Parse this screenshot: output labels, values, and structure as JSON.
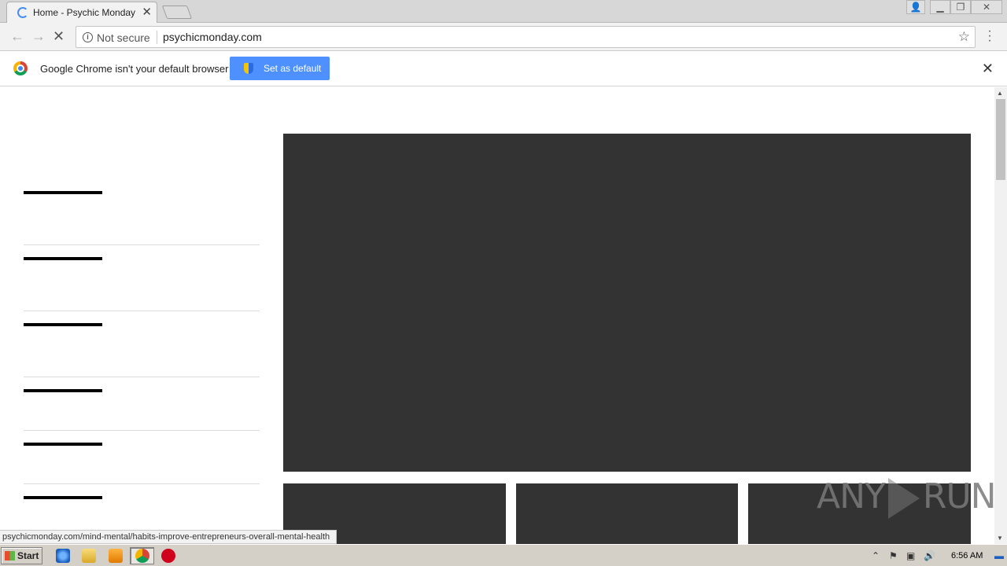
{
  "browser": {
    "tab_title": "Home - Psychic Monday",
    "tab_close": "✕",
    "security_label": "Not secure",
    "url": "psychicmonday.com",
    "status_url": "psychicmonday.com/mind-mental/habits-improve-entrepreneurs-overall-mental-health"
  },
  "infobar": {
    "message": "Google Chrome isn't your default browser",
    "set_default_label": "Set as default",
    "close": "✕"
  },
  "page": {
    "sidebar_items": 6,
    "content_colors": {
      "placeholder": "#333333",
      "nav_bar": "#000000"
    }
  },
  "watermark": {
    "left": "ANY",
    "right": "RUN"
  },
  "taskbar": {
    "start_label": "Start",
    "clock": "6:56 AM"
  },
  "colors": {
    "accent": "#4d90fe"
  }
}
